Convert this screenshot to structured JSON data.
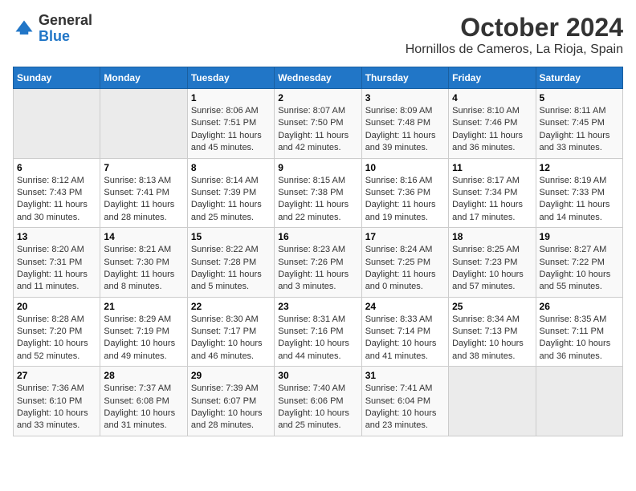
{
  "logo": {
    "general": "General",
    "blue": "Blue"
  },
  "title": "October 2024",
  "subtitle": "Hornillos de Cameros, La Rioja, Spain",
  "days_of_week": [
    "Sunday",
    "Monday",
    "Tuesday",
    "Wednesday",
    "Thursday",
    "Friday",
    "Saturday"
  ],
  "weeks": [
    [
      {
        "day": "",
        "sunrise": "",
        "sunset": "",
        "daylight": ""
      },
      {
        "day": "",
        "sunrise": "",
        "sunset": "",
        "daylight": ""
      },
      {
        "day": "1",
        "sunrise": "Sunrise: 8:06 AM",
        "sunset": "Sunset: 7:51 PM",
        "daylight": "Daylight: 11 hours and 45 minutes."
      },
      {
        "day": "2",
        "sunrise": "Sunrise: 8:07 AM",
        "sunset": "Sunset: 7:50 PM",
        "daylight": "Daylight: 11 hours and 42 minutes."
      },
      {
        "day": "3",
        "sunrise": "Sunrise: 8:09 AM",
        "sunset": "Sunset: 7:48 PM",
        "daylight": "Daylight: 11 hours and 39 minutes."
      },
      {
        "day": "4",
        "sunrise": "Sunrise: 8:10 AM",
        "sunset": "Sunset: 7:46 PM",
        "daylight": "Daylight: 11 hours and 36 minutes."
      },
      {
        "day": "5",
        "sunrise": "Sunrise: 8:11 AM",
        "sunset": "Sunset: 7:45 PM",
        "daylight": "Daylight: 11 hours and 33 minutes."
      }
    ],
    [
      {
        "day": "6",
        "sunrise": "Sunrise: 8:12 AM",
        "sunset": "Sunset: 7:43 PM",
        "daylight": "Daylight: 11 hours and 30 minutes."
      },
      {
        "day": "7",
        "sunrise": "Sunrise: 8:13 AM",
        "sunset": "Sunset: 7:41 PM",
        "daylight": "Daylight: 11 hours and 28 minutes."
      },
      {
        "day": "8",
        "sunrise": "Sunrise: 8:14 AM",
        "sunset": "Sunset: 7:39 PM",
        "daylight": "Daylight: 11 hours and 25 minutes."
      },
      {
        "day": "9",
        "sunrise": "Sunrise: 8:15 AM",
        "sunset": "Sunset: 7:38 PM",
        "daylight": "Daylight: 11 hours and 22 minutes."
      },
      {
        "day": "10",
        "sunrise": "Sunrise: 8:16 AM",
        "sunset": "Sunset: 7:36 PM",
        "daylight": "Daylight: 11 hours and 19 minutes."
      },
      {
        "day": "11",
        "sunrise": "Sunrise: 8:17 AM",
        "sunset": "Sunset: 7:34 PM",
        "daylight": "Daylight: 11 hours and 17 minutes."
      },
      {
        "day": "12",
        "sunrise": "Sunrise: 8:19 AM",
        "sunset": "Sunset: 7:33 PM",
        "daylight": "Daylight: 11 hours and 14 minutes."
      }
    ],
    [
      {
        "day": "13",
        "sunrise": "Sunrise: 8:20 AM",
        "sunset": "Sunset: 7:31 PM",
        "daylight": "Daylight: 11 hours and 11 minutes."
      },
      {
        "day": "14",
        "sunrise": "Sunrise: 8:21 AM",
        "sunset": "Sunset: 7:30 PM",
        "daylight": "Daylight: 11 hours and 8 minutes."
      },
      {
        "day": "15",
        "sunrise": "Sunrise: 8:22 AM",
        "sunset": "Sunset: 7:28 PM",
        "daylight": "Daylight: 11 hours and 5 minutes."
      },
      {
        "day": "16",
        "sunrise": "Sunrise: 8:23 AM",
        "sunset": "Sunset: 7:26 PM",
        "daylight": "Daylight: 11 hours and 3 minutes."
      },
      {
        "day": "17",
        "sunrise": "Sunrise: 8:24 AM",
        "sunset": "Sunset: 7:25 PM",
        "daylight": "Daylight: 11 hours and 0 minutes."
      },
      {
        "day": "18",
        "sunrise": "Sunrise: 8:25 AM",
        "sunset": "Sunset: 7:23 PM",
        "daylight": "Daylight: 10 hours and 57 minutes."
      },
      {
        "day": "19",
        "sunrise": "Sunrise: 8:27 AM",
        "sunset": "Sunset: 7:22 PM",
        "daylight": "Daylight: 10 hours and 55 minutes."
      }
    ],
    [
      {
        "day": "20",
        "sunrise": "Sunrise: 8:28 AM",
        "sunset": "Sunset: 7:20 PM",
        "daylight": "Daylight: 10 hours and 52 minutes."
      },
      {
        "day": "21",
        "sunrise": "Sunrise: 8:29 AM",
        "sunset": "Sunset: 7:19 PM",
        "daylight": "Daylight: 10 hours and 49 minutes."
      },
      {
        "day": "22",
        "sunrise": "Sunrise: 8:30 AM",
        "sunset": "Sunset: 7:17 PM",
        "daylight": "Daylight: 10 hours and 46 minutes."
      },
      {
        "day": "23",
        "sunrise": "Sunrise: 8:31 AM",
        "sunset": "Sunset: 7:16 PM",
        "daylight": "Daylight: 10 hours and 44 minutes."
      },
      {
        "day": "24",
        "sunrise": "Sunrise: 8:33 AM",
        "sunset": "Sunset: 7:14 PM",
        "daylight": "Daylight: 10 hours and 41 minutes."
      },
      {
        "day": "25",
        "sunrise": "Sunrise: 8:34 AM",
        "sunset": "Sunset: 7:13 PM",
        "daylight": "Daylight: 10 hours and 38 minutes."
      },
      {
        "day": "26",
        "sunrise": "Sunrise: 8:35 AM",
        "sunset": "Sunset: 7:11 PM",
        "daylight": "Daylight: 10 hours and 36 minutes."
      }
    ],
    [
      {
        "day": "27",
        "sunrise": "Sunrise: 7:36 AM",
        "sunset": "Sunset: 6:10 PM",
        "daylight": "Daylight: 10 hours and 33 minutes."
      },
      {
        "day": "28",
        "sunrise": "Sunrise: 7:37 AM",
        "sunset": "Sunset: 6:08 PM",
        "daylight": "Daylight: 10 hours and 31 minutes."
      },
      {
        "day": "29",
        "sunrise": "Sunrise: 7:39 AM",
        "sunset": "Sunset: 6:07 PM",
        "daylight": "Daylight: 10 hours and 28 minutes."
      },
      {
        "day": "30",
        "sunrise": "Sunrise: 7:40 AM",
        "sunset": "Sunset: 6:06 PM",
        "daylight": "Daylight: 10 hours and 25 minutes."
      },
      {
        "day": "31",
        "sunrise": "Sunrise: 7:41 AM",
        "sunset": "Sunset: 6:04 PM",
        "daylight": "Daylight: 10 hours and 23 minutes."
      },
      {
        "day": "",
        "sunrise": "",
        "sunset": "",
        "daylight": ""
      },
      {
        "day": "",
        "sunrise": "",
        "sunset": "",
        "daylight": ""
      }
    ]
  ]
}
